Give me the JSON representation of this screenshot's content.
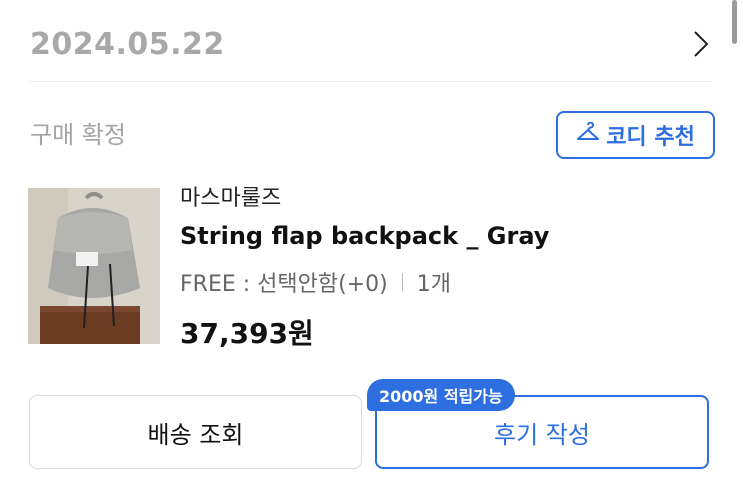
{
  "order": {
    "date": "2024.05.22",
    "status": "구매 확정"
  },
  "coordi_button": {
    "label": "코디 추천",
    "icon": "hanger-icon"
  },
  "product": {
    "brand": "마스마룰즈",
    "name": "String flap backpack _ Gray",
    "option": "FREE : 선택안함(+0)",
    "quantity": "1개",
    "price": "37,393원",
    "image": "gray backpack photo"
  },
  "actions": {
    "delivery_label": "배송 조회",
    "review_label": "후기 작성",
    "review_badge": "2000원 적립가능"
  },
  "colors": {
    "accent": "#2d6ee0",
    "muted_text": "#a8a8a8"
  }
}
